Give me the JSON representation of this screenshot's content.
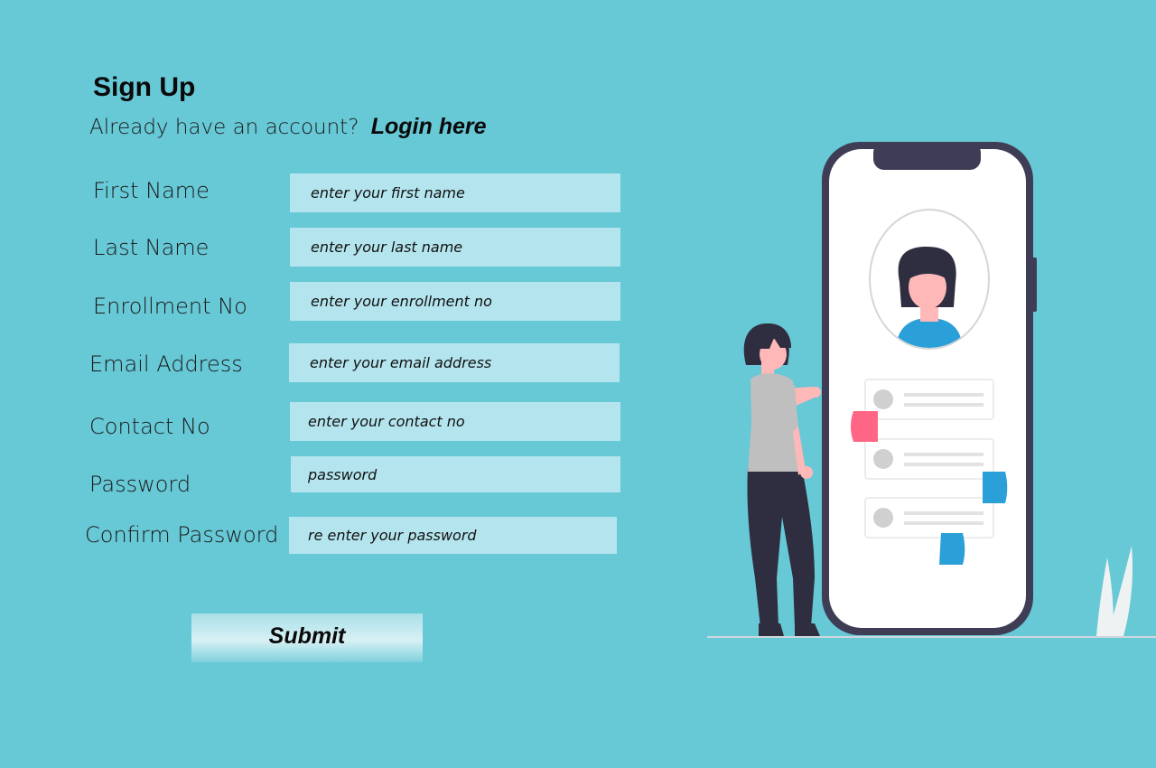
{
  "form": {
    "title": "Sign Up",
    "login_prompt": "Already have an account?",
    "login_link": "Login here",
    "fields": [
      {
        "label": "First Name",
        "placeholder": "enter your first name",
        "value": ""
      },
      {
        "label": "Last Name",
        "placeholder": "enter your last name",
        "value": ""
      },
      {
        "label": "Enrollment No",
        "placeholder": "enter your enrollment no",
        "value": ""
      },
      {
        "label": "Email Address",
        "placeholder": "enter your email address",
        "value": ""
      },
      {
        "label": "Contact No",
        "placeholder": "enter your contact no",
        "value": ""
      },
      {
        "label": "Password",
        "placeholder": "password",
        "value": ""
      },
      {
        "label": "Confirm Password",
        "placeholder": "re enter your password",
        "value": ""
      }
    ],
    "submit_label": "Submit"
  },
  "illustration": {
    "name": "woman-with-phone-profile-illustration",
    "colors": {
      "background": "#67c8d6",
      "input_fill": "#b4e5ee",
      "phone_frame": "#3f3d56",
      "accent_pink": "#ff6584",
      "accent_blue": "#2a9fd8"
    }
  }
}
